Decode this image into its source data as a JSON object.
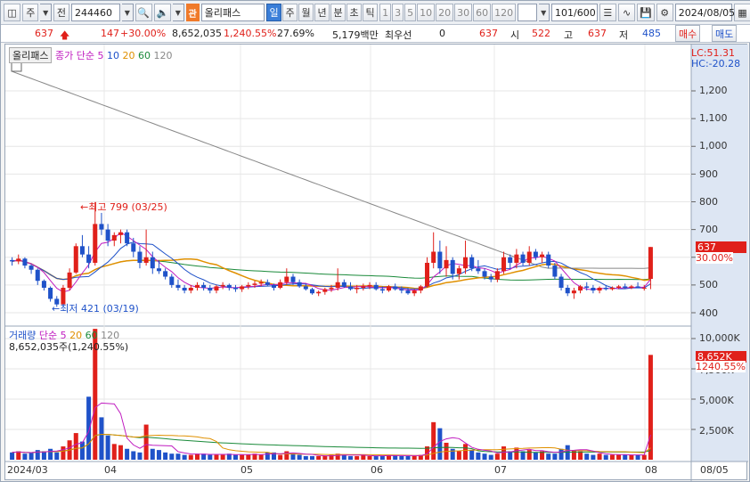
{
  "toolbar": {
    "tab1": "주",
    "tab2": "전",
    "code": "244460",
    "badge": "관",
    "name": "올리패스",
    "periods": [
      "일",
      "주",
      "월",
      "년",
      "분",
      "초",
      "틱"
    ],
    "active_period": "일",
    "intervals": [
      "1",
      "3",
      "5",
      "10",
      "20",
      "30",
      "60",
      "120"
    ],
    "count": "101",
    "count_total": "/600",
    "date": "2024/08/05"
  },
  "quote": {
    "price": "637",
    "change": "147",
    "change_pct": "+30.00%",
    "volume": "8,652,035",
    "volume_pct": "1,240.55%",
    "turnover_rate": "27.69%",
    "amount": "5,179백만",
    "best_bid_label": "최우선",
    "best_bid_value": "0",
    "best_ask": "637",
    "open_label": "시",
    "open": "522",
    "high_label": "고",
    "high": "637",
    "low_label": "저",
    "low": "485",
    "buy_label": "매수",
    "sell_label": "매도"
  },
  "price_panel": {
    "title": "올리패스",
    "ma_label": "종가 단순",
    "ma_periods": [
      "5",
      "10",
      "20",
      "60",
      "120"
    ],
    "lc": "LC:51.31",
    "hc": "HC:-20.28",
    "y_ticks": [
      "1,200",
      "1,100",
      "1,000",
      "900",
      "800",
      "700",
      "600",
      "500",
      "400"
    ],
    "last_price": "637",
    "last_change": "30.00%",
    "high_annotation": "최고 799 (03/25)",
    "low_annotation": "최저 421 (03/19)"
  },
  "volume_panel": {
    "title": "거래량",
    "ma_label": "단순",
    "ma_periods": [
      "5",
      "20",
      "60",
      "120"
    ],
    "summary": "8,652,035주(1,240.55%)",
    "y_ticks": [
      "10,000K",
      "7,500K",
      "5,000K",
      "2,500K"
    ],
    "last_volume": "8,652K",
    "last_pct": "1240.55%"
  },
  "x_axis": {
    "labels": [
      "2024/03",
      "04",
      "05",
      "06",
      "07",
      "08",
      "08/05"
    ]
  },
  "colors": {
    "up": "#e0201a",
    "down": "#1f52c9",
    "ma5": "#c01cc0",
    "ma10": "#1f52c9",
    "ma20": "#e09000",
    "ma60": "#1a8a3a",
    "ma120": "#888888"
  },
  "chart_data": [
    {
      "type": "candlestick",
      "title": "올리패스",
      "ylim": [
        380,
        1300
      ],
      "x_labels": [
        "2024/03",
        "04",
        "05",
        "06",
        "07",
        "08"
      ],
      "annotations": [
        {
          "text": "최고 799 (03/25)",
          "value": 799,
          "date": "03/25"
        },
        {
          "text": "최저 421 (03/19)",
          "value": 421,
          "date": "03/19"
        }
      ],
      "ohlc": [
        [
          590,
          600,
          570,
          585
        ],
        [
          585,
          610,
          575,
          595
        ],
        [
          595,
          600,
          560,
          570
        ],
        [
          570,
          575,
          540,
          555
        ],
        [
          555,
          560,
          500,
          515
        ],
        [
          515,
          520,
          480,
          490
        ],
        [
          490,
          495,
          440,
          450
        ],
        [
          450,
          460,
          421,
          430
        ],
        [
          430,
          500,
          425,
          490
        ],
        [
          490,
          560,
          480,
          545
        ],
        [
          545,
          650,
          540,
          640
        ],
        [
          640,
          680,
          600,
          610
        ],
        [
          610,
          640,
          560,
          580
        ],
        [
          580,
          799,
          570,
          720
        ],
        [
          720,
          760,
          680,
          700
        ],
        [
          700,
          720,
          640,
          660
        ],
        [
          660,
          690,
          640,
          680
        ],
        [
          680,
          700,
          650,
          690
        ],
        [
          690,
          700,
          640,
          650
        ],
        [
          650,
          670,
          600,
          620
        ],
        [
          620,
          640,
          560,
          580
        ],
        [
          580,
          700,
          570,
          600
        ],
        [
          600,
          620,
          540,
          560
        ],
        [
          560,
          590,
          540,
          550
        ],
        [
          550,
          560,
          520,
          530
        ],
        [
          530,
          540,
          490,
          500
        ],
        [
          500,
          520,
          480,
          490
        ],
        [
          490,
          500,
          470,
          480
        ],
        [
          480,
          500,
          470,
          490
        ],
        [
          490,
          510,
          480,
          500
        ],
        [
          500,
          510,
          480,
          490
        ],
        [
          490,
          500,
          470,
          480
        ],
        [
          480,
          500,
          470,
          495
        ],
        [
          495,
          510,
          485,
          500
        ],
        [
          500,
          505,
          480,
          490
        ],
        [
          490,
          500,
          475,
          485
        ],
        [
          485,
          500,
          475,
          495
        ],
        [
          495,
          510,
          485,
          500
        ],
        [
          500,
          515,
          490,
          505
        ],
        [
          505,
          520,
          495,
          510
        ],
        [
          510,
          520,
          495,
          500
        ],
        [
          500,
          505,
          480,
          490
        ],
        [
          490,
          520,
          485,
          510
        ],
        [
          510,
          560,
          500,
          530
        ],
        [
          530,
          540,
          500,
          510
        ],
        [
          510,
          520,
          490,
          495
        ],
        [
          495,
          505,
          480,
          485
        ],
        [
          485,
          490,
          465,
          470
        ],
        [
          470,
          480,
          460,
          475
        ],
        [
          475,
          490,
          465,
          485
        ],
        [
          485,
          500,
          475,
          490
        ],
        [
          490,
          560,
          480,
          510
        ],
        [
          510,
          520,
          490,
          495
        ],
        [
          495,
          510,
          480,
          485
        ],
        [
          485,
          500,
          470,
          490
        ],
        [
          490,
          505,
          480,
          495
        ],
        [
          495,
          510,
          485,
          500
        ],
        [
          500,
          510,
          480,
          485
        ],
        [
          485,
          495,
          470,
          480
        ],
        [
          480,
          500,
          475,
          495
        ],
        [
          495,
          505,
          480,
          485
        ],
        [
          485,
          495,
          470,
          480
        ],
        [
          480,
          490,
          465,
          470
        ],
        [
          470,
          485,
          460,
          480
        ],
        [
          480,
          500,
          470,
          495
        ],
        [
          495,
          600,
          490,
          580
        ],
        [
          580,
          690,
          560,
          620
        ],
        [
          620,
          660,
          540,
          560
        ],
        [
          560,
          640,
          530,
          590
        ],
        [
          590,
          600,
          520,
          540
        ],
        [
          540,
          570,
          520,
          560
        ],
        [
          560,
          660,
          540,
          600
        ],
        [
          600,
          610,
          550,
          560
        ],
        [
          560,
          590,
          540,
          550
        ],
        [
          550,
          560,
          520,
          530
        ],
        [
          530,
          540,
          510,
          520
        ],
        [
          520,
          560,
          510,
          550
        ],
        [
          550,
          620,
          540,
          600
        ],
        [
          600,
          610,
          560,
          580
        ],
        [
          580,
          630,
          560,
          610
        ],
        [
          610,
          620,
          570,
          580
        ],
        [
          580,
          640,
          570,
          620
        ],
        [
          620,
          630,
          590,
          600
        ],
        [
          600,
          620,
          580,
          610
        ],
        [
          610,
          620,
          560,
          570
        ],
        [
          570,
          580,
          520,
          530
        ],
        [
          530,
          540,
          480,
          490
        ],
        [
          490,
          500,
          460,
          470
        ],
        [
          470,
          490,
          450,
          480
        ],
        [
          480,
          500,
          470,
          495
        ],
        [
          495,
          510,
          480,
          490
        ],
        [
          490,
          500,
          470,
          480
        ],
        [
          480,
          495,
          470,
          490
        ],
        [
          490,
          500,
          480,
          485
        ],
        [
          485,
          495,
          480,
          490
        ],
        [
          490,
          500,
          485,
          495
        ],
        [
          495,
          505,
          485,
          490
        ],
        [
          490,
          500,
          485,
          495
        ],
        [
          495,
          510,
          490,
          490
        ],
        [
          490,
          500,
          480,
          490
        ],
        [
          522,
          637,
          485,
          637
        ]
      ]
    },
    {
      "type": "bar",
      "title": "거래량",
      "ylim": [
        0,
        11000
      ],
      "unit": "K",
      "values": [
        600,
        700,
        500,
        550,
        800,
        700,
        900,
        600,
        1100,
        1600,
        2200,
        1500,
        5200,
        11000,
        3500,
        2000,
        1300,
        1200,
        900,
        700,
        600,
        2900,
        900,
        800,
        600,
        500,
        500,
        400,
        400,
        500,
        500,
        400,
        400,
        400,
        500,
        400,
        400,
        400,
        500,
        400,
        600,
        600,
        400,
        700,
        500,
        400,
        300,
        300,
        300,
        300,
        400,
        500,
        400,
        300,
        300,
        400,
        300,
        300,
        300,
        400,
        400,
        300,
        300,
        300,
        400,
        1100,
        3100,
        2600,
        1400,
        900,
        700,
        1300,
        800,
        600,
        500,
        400,
        500,
        1100,
        700,
        1000,
        700,
        800,
        600,
        700,
        500,
        500,
        900,
        1200,
        800,
        700,
        500,
        400,
        500,
        400,
        400,
        400,
        400,
        400,
        400,
        400,
        8652
      ]
    }
  ]
}
